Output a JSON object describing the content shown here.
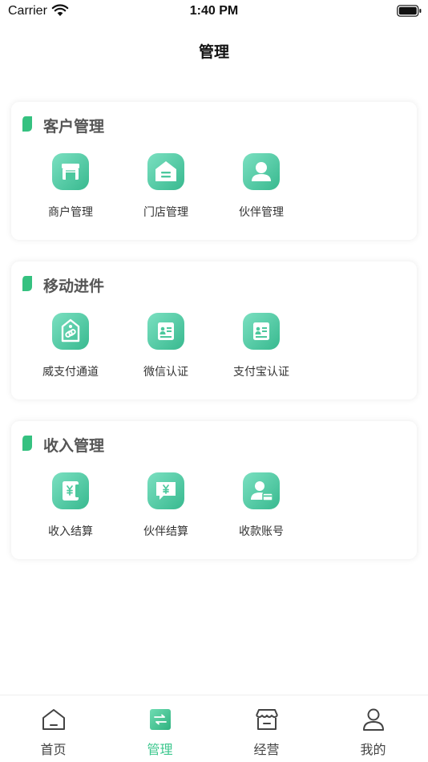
{
  "status_bar": {
    "carrier": "Carrier",
    "time": "1:40 PM"
  },
  "nav": {
    "title": "管理"
  },
  "colors": {
    "accent": "#3cc78e",
    "icon_gradient_start": "#7be0c1",
    "icon_gradient_end": "#38b98f",
    "section_title": "#555555"
  },
  "sections": [
    {
      "title": "客户管理",
      "items": [
        {
          "label": "商户管理",
          "icon": "store-icon"
        },
        {
          "label": "门店管理",
          "icon": "house-icon"
        },
        {
          "label": "伙伴管理",
          "icon": "person-icon"
        }
      ]
    },
    {
      "title": "移动进件",
      "items": [
        {
          "label": "威支付通道",
          "icon": "link-tag-icon"
        },
        {
          "label": "微信认证",
          "icon": "id-card-icon"
        },
        {
          "label": "支付宝认证",
          "icon": "id-card-icon"
        }
      ]
    },
    {
      "title": "收入管理",
      "items": [
        {
          "label": "收入结算",
          "icon": "yen-wallet-icon"
        },
        {
          "label": "伙伴结算",
          "icon": "yen-chat-icon"
        },
        {
          "label": "收款账号",
          "icon": "user-card-icon"
        }
      ]
    }
  ],
  "tab_bar": {
    "active": "管理",
    "tabs": [
      {
        "label": "首页",
        "icon": "home-icon"
      },
      {
        "label": "管理",
        "icon": "manage-icon"
      },
      {
        "label": "经营",
        "icon": "shop-icon"
      },
      {
        "label": "我的",
        "icon": "profile-icon"
      }
    ]
  }
}
